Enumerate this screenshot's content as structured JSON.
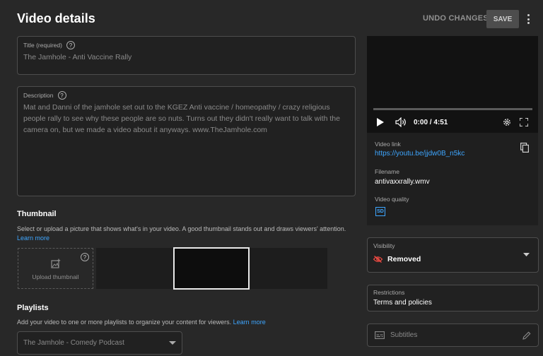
{
  "header": {
    "title": "Video details",
    "undo_label": "UNDO CHANGES",
    "save_label": "SAVE"
  },
  "title_field": {
    "label": "Title (required)",
    "value": "The Jamhole - Anti Vaccine Rally"
  },
  "description_field": {
    "label": "Description",
    "value": "Mat and Danni of the jamhole set out to the KGEZ Anti vaccine / homeopathy / crazy religious people rally to see why these people are so nuts. Turns out they didn't really want to talk with the camera on, but we made a video about it anyways.  www.TheJamhole.com"
  },
  "thumbnail": {
    "heading": "Thumbnail",
    "description": "Select or upload a picture that shows what's in your video. A good thumbnail stands out and draws viewers' attention.",
    "learn_more": "Learn more",
    "upload_label": "Upload thumbnail"
  },
  "playlists": {
    "heading": "Playlists",
    "description": "Add your video to one or more playlists to organize your content for viewers.",
    "learn_more": "Learn more",
    "selected": "The Jamhole - Comedy Podcast"
  },
  "player": {
    "time": "0:00 / 4:51",
    "progress": 0
  },
  "video_info": {
    "link_label": "Video link",
    "link_value": "https://youtu.be/jjdw0B_n5kc",
    "filename_label": "Filename",
    "filename_value": "antivaxxrally.wmv",
    "quality_label": "Video quality",
    "quality_badge": "SD"
  },
  "visibility": {
    "label": "Visibility",
    "value": "Removed"
  },
  "restrictions": {
    "label": "Restrictions",
    "value": "Terms and policies"
  },
  "subtitles": {
    "label": "Subtitles"
  },
  "colors": {
    "background": "#282828",
    "link": "#3ea6ff",
    "removed_icon": "#ff4e45"
  }
}
